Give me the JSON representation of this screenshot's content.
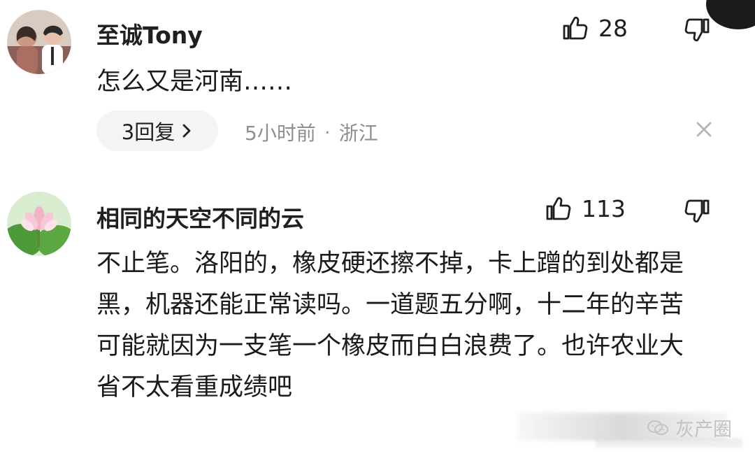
{
  "comments": [
    {
      "username": "至诚Tony",
      "text": "怎么又是河南……",
      "likes": "28",
      "reply_label": "3回复",
      "time": "5小时前",
      "location": "浙江",
      "meta_separator": "·"
    },
    {
      "username": "相同的天空不同的云",
      "text": "不止笔。洛阳的，橡皮硬还擦不掉，卡上蹭的到处都是黑，机器还能正常读吗。一道题五分啊，十二年的辛苦可能就因为一支笔一个橡皮而白白浪费了。也许农业大省不太看重成绩吧",
      "likes": "113"
    }
  ],
  "watermark": {
    "label": "灰产圈"
  },
  "icons": {
    "like": "thumb-up-icon",
    "dislike": "thumb-down-icon",
    "chevron": "chevron-right-icon",
    "close": "close-icon",
    "watermark": "wechat-icon"
  },
  "colors": {
    "background": "#ffffff",
    "primary_text": "#1a1a1a",
    "secondary_text": "#8f8f8f",
    "pill_background": "#f4f4f4",
    "icon": "#1f1f1f",
    "close_icon": "#b5b5b5",
    "watermark": "#c2c2c2"
  }
}
